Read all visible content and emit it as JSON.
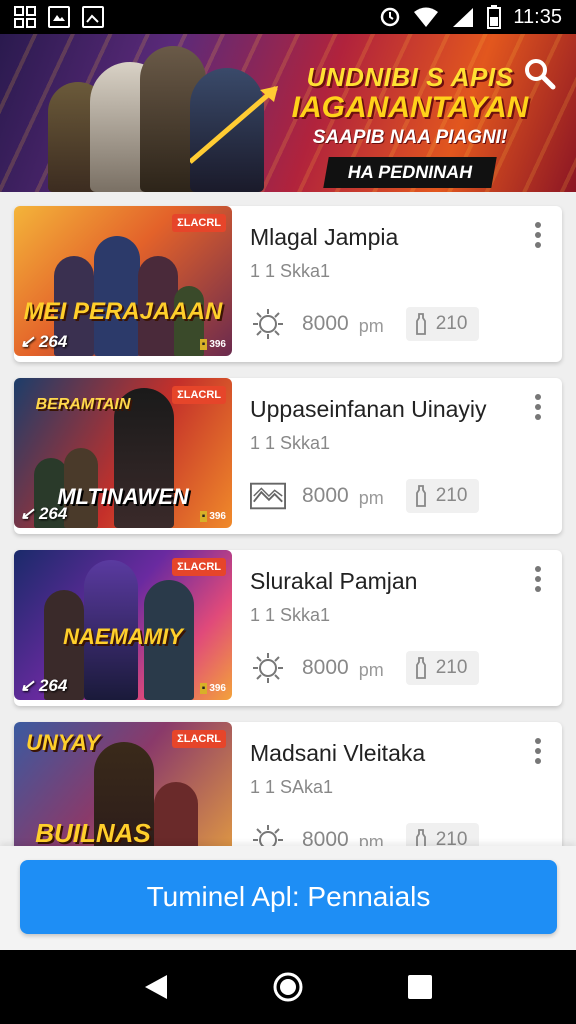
{
  "status_bar": {
    "time": "11:35",
    "left_icons": [
      "grid-icon",
      "image-icon",
      "photo-icon"
    ],
    "right_icons": [
      "sync-icon",
      "wifi-icon",
      "signal-icon",
      "battery-icon"
    ]
  },
  "banner": {
    "line1": "UNDNIBI S APIS",
    "line2": "IAGANANTAYAN",
    "line3": "SAAPIB NAA PIAGNI!",
    "line4": "HA PEDNINAH",
    "search_icon": "search-icon"
  },
  "games": [
    {
      "title": "Mlagal Jampia",
      "subtitle": "1 1 Skka1",
      "time": "8000",
      "unit": "pm",
      "badge": "210",
      "meta_icon": "sun-icon",
      "thumb": {
        "tag": "ΣLACRL",
        "art_text": "MEI PERAJAAAN",
        "count": "264",
        "rating": "396"
      }
    },
    {
      "title": "Uppaseinfanan Uinayiy",
      "subtitle": "1 1 Skka1",
      "time": "8000",
      "unit": "pm",
      "badge": "210",
      "meta_icon": "chart-icon",
      "thumb": {
        "tag": "ΣLACRL",
        "art_text_top": "BERAMTAIN",
        "art_text": "MLTINAWEN",
        "count": "264",
        "rating": "396"
      }
    },
    {
      "title": "Slurakal Pamjan",
      "subtitle": "1 1 Skka1",
      "time": "8000",
      "unit": "pm",
      "badge": "210",
      "meta_icon": "sun-icon",
      "thumb": {
        "tag": "ΣLACRL",
        "art_text": "NAEMAMIY",
        "count": "264",
        "rating": "396"
      }
    },
    {
      "title": "Madsani Vleitaka",
      "subtitle": "1 1 SAka1",
      "time": "8000",
      "unit": "pm",
      "badge": "210",
      "meta_icon": "sun-icon",
      "thumb": {
        "tag": "ΣLACRL",
        "art_text_top": "UNYAY",
        "art_text": "BUILNAS",
        "count": "",
        "rating": ""
      }
    }
  ],
  "cta": {
    "label": "Tuminel Apl: Pennaials"
  },
  "nav": {
    "back": "back-icon",
    "home": "home-icon",
    "recents": "recents-icon"
  },
  "colors": {
    "cta": "#1e8ef5",
    "banner_text": "#ffd21a",
    "tag": "#e6452a"
  }
}
